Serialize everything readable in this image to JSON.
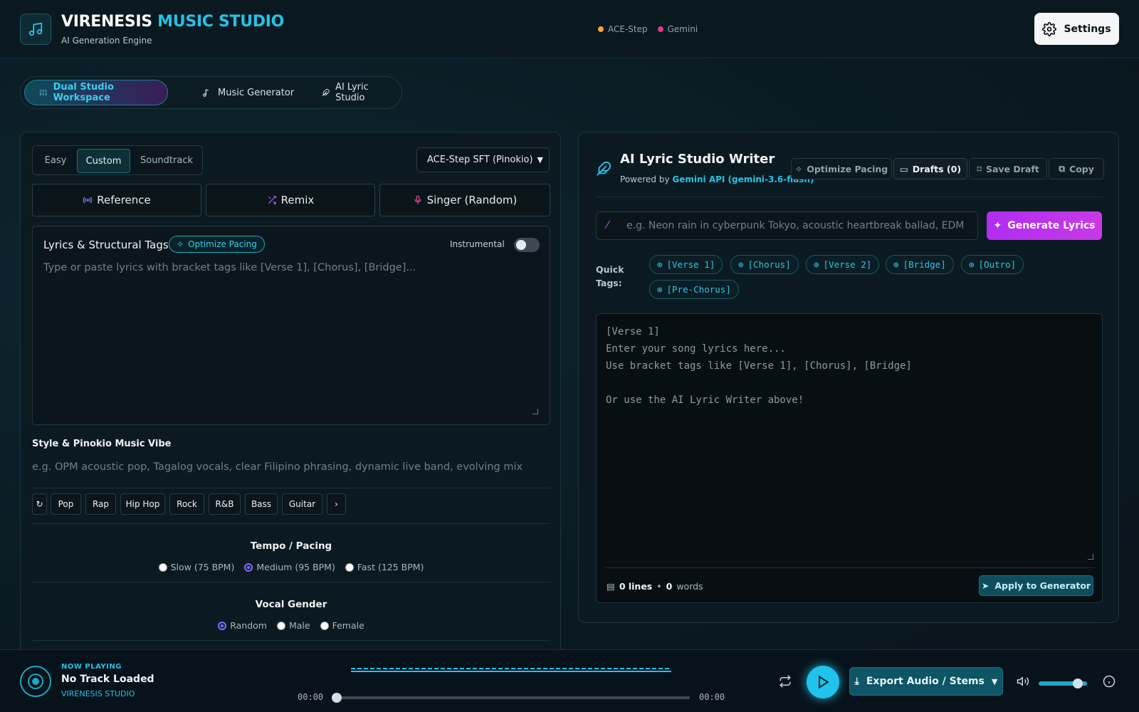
{
  "header": {
    "brand_a": "VIRENESIS",
    "brand_b": "MUSIC STUDIO",
    "subtitle": "AI Generation Engine",
    "status": [
      {
        "label": "ACE-Step",
        "color": "#f5a524"
      },
      {
        "label": "Gemini",
        "color": "#e5368f"
      }
    ],
    "settings_label": "Settings"
  },
  "tabs": [
    {
      "label": "Dual Studio Workspace",
      "icon": "sliders-icon",
      "active": true
    },
    {
      "label": "Music Generator",
      "icon": "music-note-icon"
    },
    {
      "label": "AI Lyric Studio",
      "icon": "feather-icon"
    }
  ],
  "left": {
    "modes": [
      "Easy",
      "Custom",
      "Soundtrack"
    ],
    "active_mode": "Custom",
    "model_select": "ACE-Step SFT (Pinokio)",
    "actions": [
      {
        "label": "Reference",
        "icon": "broadcast-icon",
        "color": "#8b7bff"
      },
      {
        "label": "Remix",
        "icon": "shuffle-icon",
        "color": "#b05bf0"
      },
      {
        "label": "Singer (Random)",
        "icon": "mic-icon",
        "color": "#e8509c"
      }
    ],
    "lyrics": {
      "title": "Lyrics & Structural Tags",
      "optimize_label": "Optimize Pacing",
      "instrumental_label": "Instrumental",
      "placeholder": "Type or paste lyrics with bracket tags like [Verse 1], [Chorus], [Bridge]..."
    },
    "style": {
      "title": "Style & Pinokio Music Vibe",
      "placeholder": "e.g. OPM acoustic pop, Tagalog vocals, clear Filipino phrasing, dynamic live band, evolving mix",
      "chips": [
        "↻",
        "Pop",
        "Rap",
        "Hip Hop",
        "Rock",
        "R&B",
        "Bass",
        "Guitar",
        "›"
      ]
    },
    "tempo": {
      "title": "Tempo / Pacing",
      "options": [
        "Slow (75 BPM)",
        "Medium (95 BPM)",
        "Fast (125 BPM)"
      ],
      "selected": "Medium (95 BPM)"
    },
    "vocal": {
      "title": "Vocal Gender",
      "options": [
        "Random",
        "Male",
        "Female"
      ],
      "selected": "Random"
    }
  },
  "right": {
    "title": "AI Lyric Studio Writer",
    "powered_prefix": "Powered by",
    "powered_by": "Gemini API (gemini-3.6-flash)",
    "toolbar": [
      "Optimize Pacing",
      "Drafts (0)",
      "Save Draft",
      "Copy"
    ],
    "prompt_placeholder": "e.g. Neon rain in cyberpunk Tokyo, acoustic heartbreak ballad, EDM night fli",
    "generate_label": "Generate Lyrics",
    "quick_tags_label": "Quick Tags:",
    "quick_tags": [
      "[Verse 1]",
      "[Chorus]",
      "[Verse 2]",
      "[Bridge]",
      "[Outro]",
      "[Pre-Chorus]"
    ],
    "editor_placeholder": "[Verse 1]\nEnter your song lyrics here...\nUse bracket tags like [Verse 1], [Chorus], [Bridge]\n\nOr use the AI Lyric Writer above!",
    "lines": "0 lines",
    "words": "0",
    "words_label": "words",
    "apply_label": "Apply to Generator"
  },
  "player": {
    "label": "NOW PLAYING",
    "title": "No Track Loaded",
    "artist": "VIRENESIS STUDIO",
    "time_current": "00:00",
    "time_total": "00:00",
    "progress": 0,
    "volume": 0.8,
    "export_label": "Export Audio / Stems"
  }
}
